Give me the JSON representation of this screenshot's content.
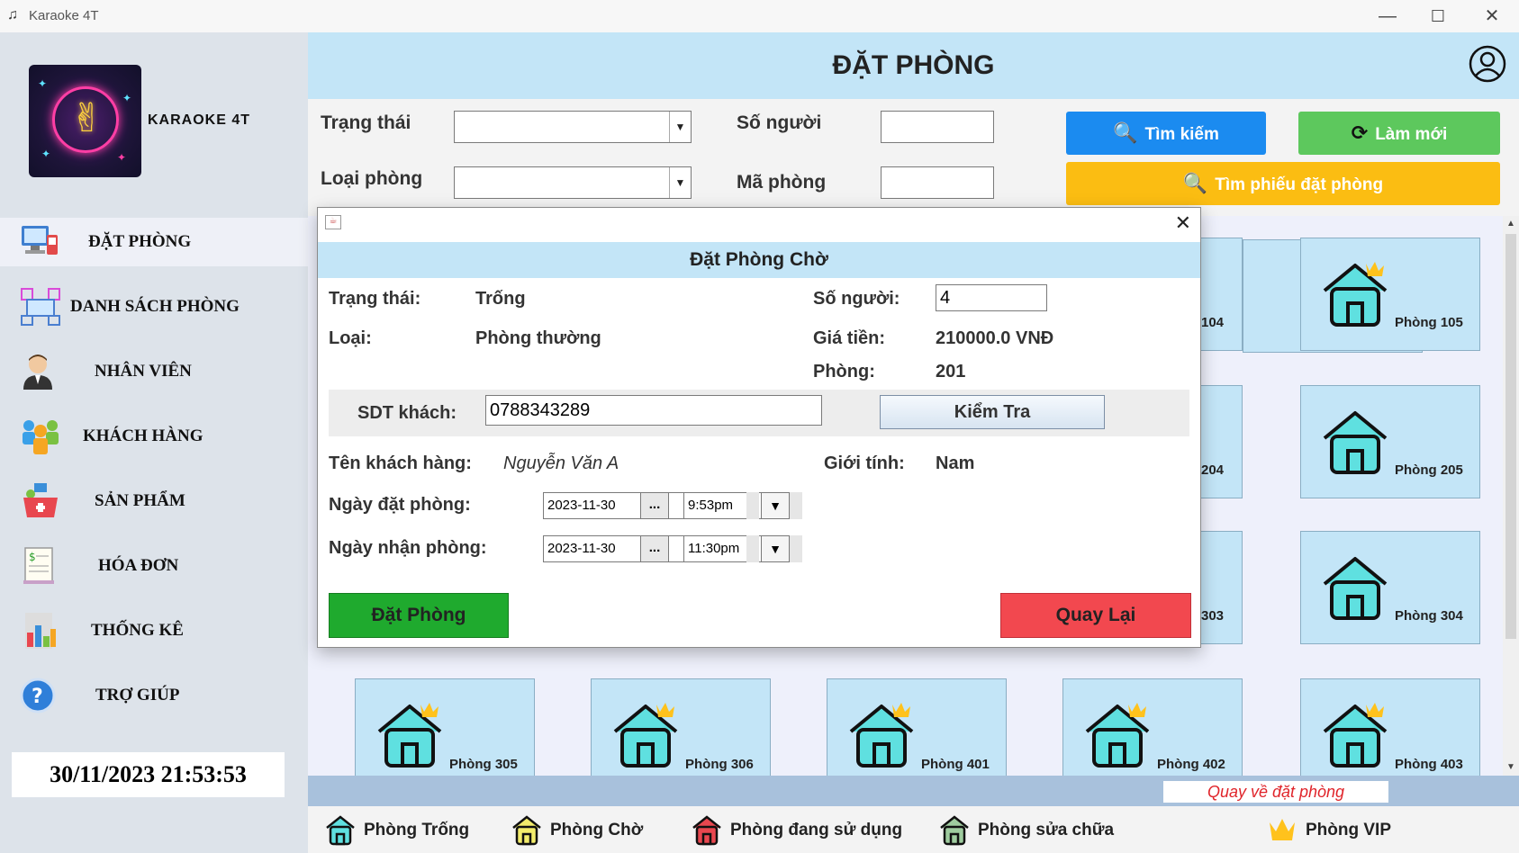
{
  "window": {
    "title": "Karaoke 4T",
    "minimize": "—",
    "maximize": "☐",
    "close": "✕"
  },
  "sidebar": {
    "brand": "KARAOKE 4T",
    "items": [
      {
        "label": "ĐẶT PHÒNG",
        "icon": "booking-computer-icon"
      },
      {
        "label": "DANH SÁCH PHÒNG",
        "icon": "room-list-icon"
      },
      {
        "label": "NHÂN VIÊN",
        "icon": "employee-icon"
      },
      {
        "label": "KHÁCH HÀNG",
        "icon": "customers-icon"
      },
      {
        "label": "SẢN PHẨM",
        "icon": "product-basket-icon"
      },
      {
        "label": "HÓA ĐƠN",
        "icon": "invoice-icon"
      },
      {
        "label": "THỐNG KÊ",
        "icon": "statistics-icon"
      },
      {
        "label": "TRỢ GIÚP",
        "icon": "help-icon"
      }
    ],
    "clock": "30/11/2023 21:53:53"
  },
  "header": {
    "title": "ĐẶT PHÒNG"
  },
  "filters": {
    "status_label": "Trạng thái",
    "room_type_label": "Loại phòng",
    "people_label": "Số người",
    "room_code_label": "Mã phòng",
    "search_label": "Tìm kiếm",
    "refresh_label": "Làm mới",
    "find_booking_label": "Tìm phiếu đặt phòng"
  },
  "rooms": {
    "col1_row1": "104",
    "col2_row1": "Phòng 105",
    "col1_row2": "204",
    "col2_row2": "Phòng 205",
    "col1_row3": "303",
    "col2_row3": "Phòng 304",
    "row4": [
      "Phòng 305",
      "Phòng 306",
      "Phòng 401",
      "Phòng 402",
      "Phòng 403"
    ]
  },
  "bottom": {
    "return_link": "Quay về đặt phòng"
  },
  "legend": [
    {
      "label": "Phòng Trống",
      "color": "#5fe0e0"
    },
    {
      "label": "Phòng Chờ",
      "color": "#f2ec6c"
    },
    {
      "label": "Phòng đang sử dụng",
      "color": "#e8474f"
    },
    {
      "label": "Phòng sửa chữa",
      "color": "#9fcc9f"
    },
    {
      "label": "Phòng VIP",
      "color": "#ffc21c"
    }
  ],
  "dialog": {
    "title": "Đặt Phòng Chờ",
    "status_label": "Trạng thái:",
    "status_value": "Trống",
    "people_label": "Số người:",
    "people_value": "4",
    "type_label": "Loại:",
    "type_value": "Phòng thường",
    "price_label": "Giá tiền:",
    "price_value": "210000.0 VNĐ",
    "room_label": "Phòng:",
    "room_value": "201",
    "phone_label": "SDT khách:",
    "phone_value": "0788343289",
    "check_label": "Kiểm Tra",
    "customer_label": "Tên khách hàng:",
    "customer_value": "Nguyễn Văn A",
    "gender_label": "Giới tính:",
    "gender_value": "Nam",
    "book_date_label": "Ngày đặt  phòng:",
    "book_date_value": "2023-11-30",
    "book_time_value": "9:53pm",
    "receive_date_label": "Ngày nhận phòng:",
    "receive_date_value": "2023-11-30",
    "receive_time_value": "11:30pm",
    "dots": "...",
    "spin": "▼",
    "book_button": "Đặt Phòng",
    "back_button": "Quay Lại"
  }
}
